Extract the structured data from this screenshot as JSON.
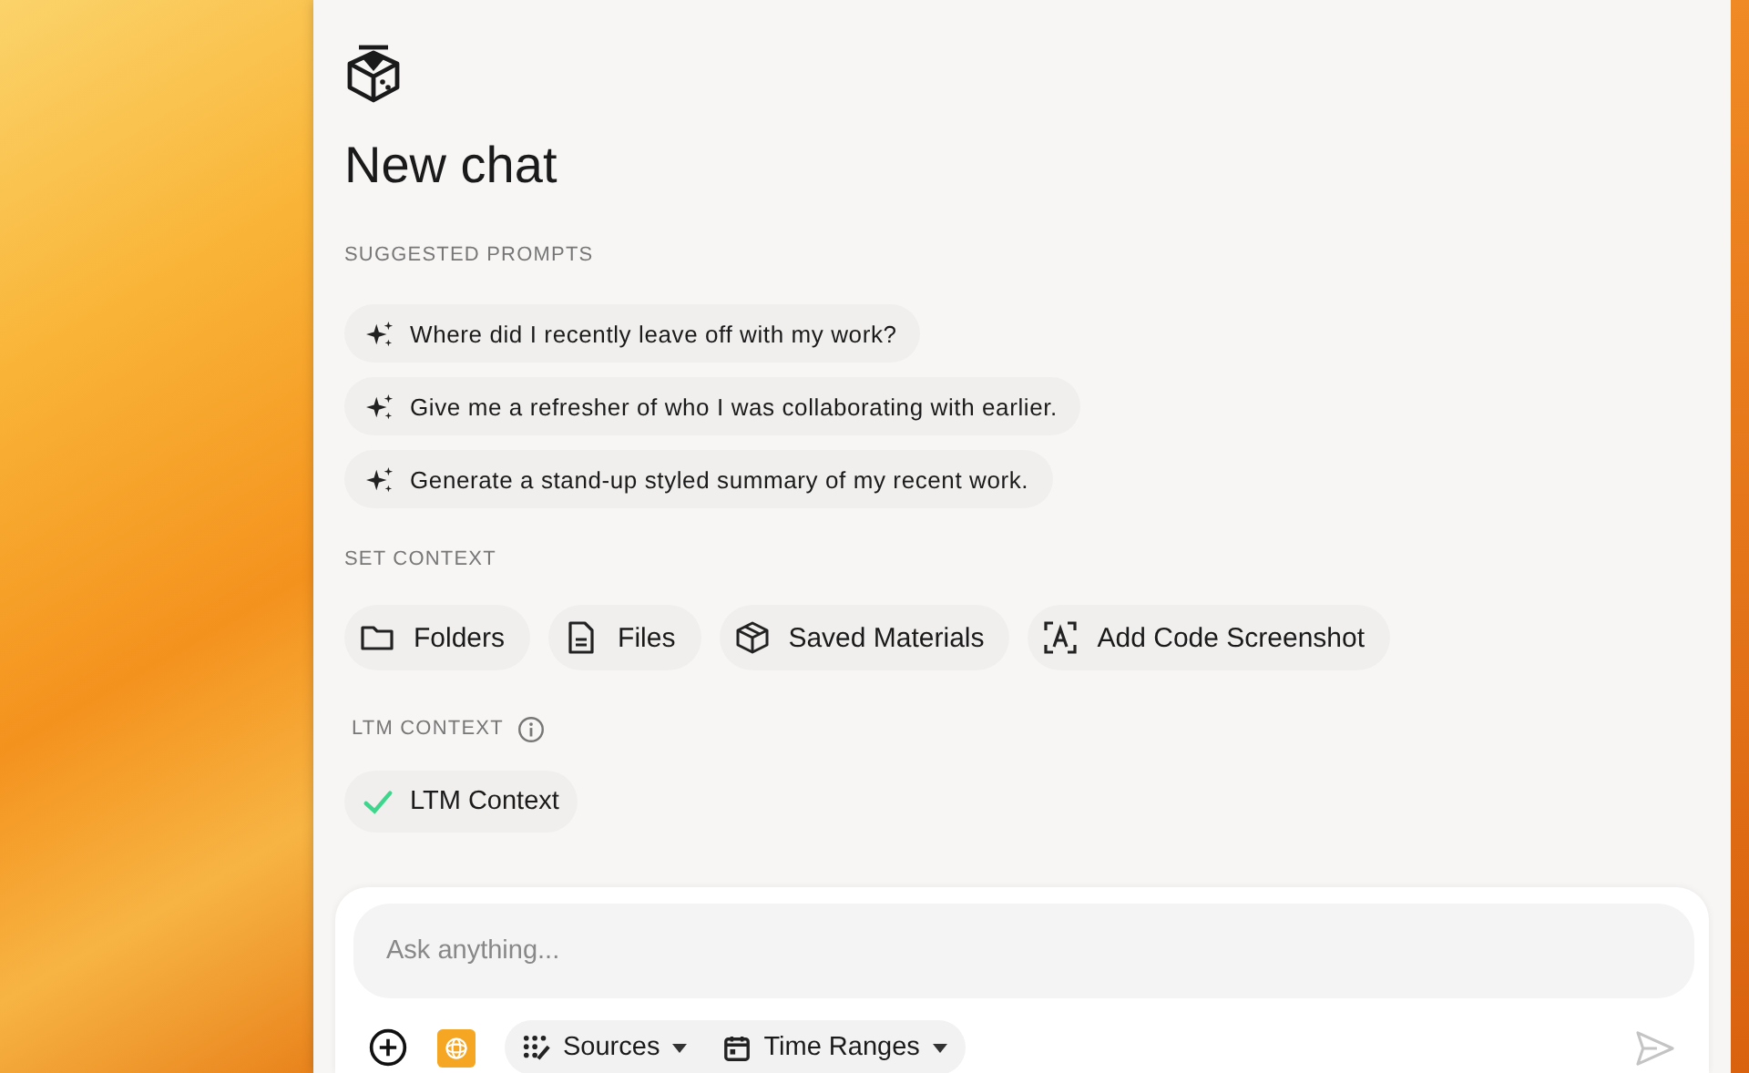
{
  "title": "New chat",
  "suggested_prompts": {
    "heading": "SUGGESTED PROMPTS",
    "items": [
      {
        "text": "Where did I recently leave off with my work?"
      },
      {
        "text": "Give me a refresher of who I was collaborating with earlier."
      },
      {
        "text": "Generate a stand-up styled summary of my recent work."
      }
    ]
  },
  "set_context": {
    "heading": "SET CONTEXT",
    "items": [
      {
        "kind": "folder",
        "label": "Folders"
      },
      {
        "kind": "file",
        "label": "Files"
      },
      {
        "kind": "package",
        "label": "Saved Materials"
      },
      {
        "kind": "screenshot",
        "label": "Add Code Screenshot"
      }
    ]
  },
  "ltm_context": {
    "heading": "LTM CONTEXT",
    "items": [
      {
        "label": "LTM Context",
        "checked": true
      }
    ]
  },
  "composer": {
    "placeholder": "Ask anything...",
    "dropdowns": [
      {
        "kind": "sources",
        "label": "Sources"
      },
      {
        "kind": "calendar",
        "label": "Time Ranges"
      }
    ],
    "send_disabled": true
  }
}
